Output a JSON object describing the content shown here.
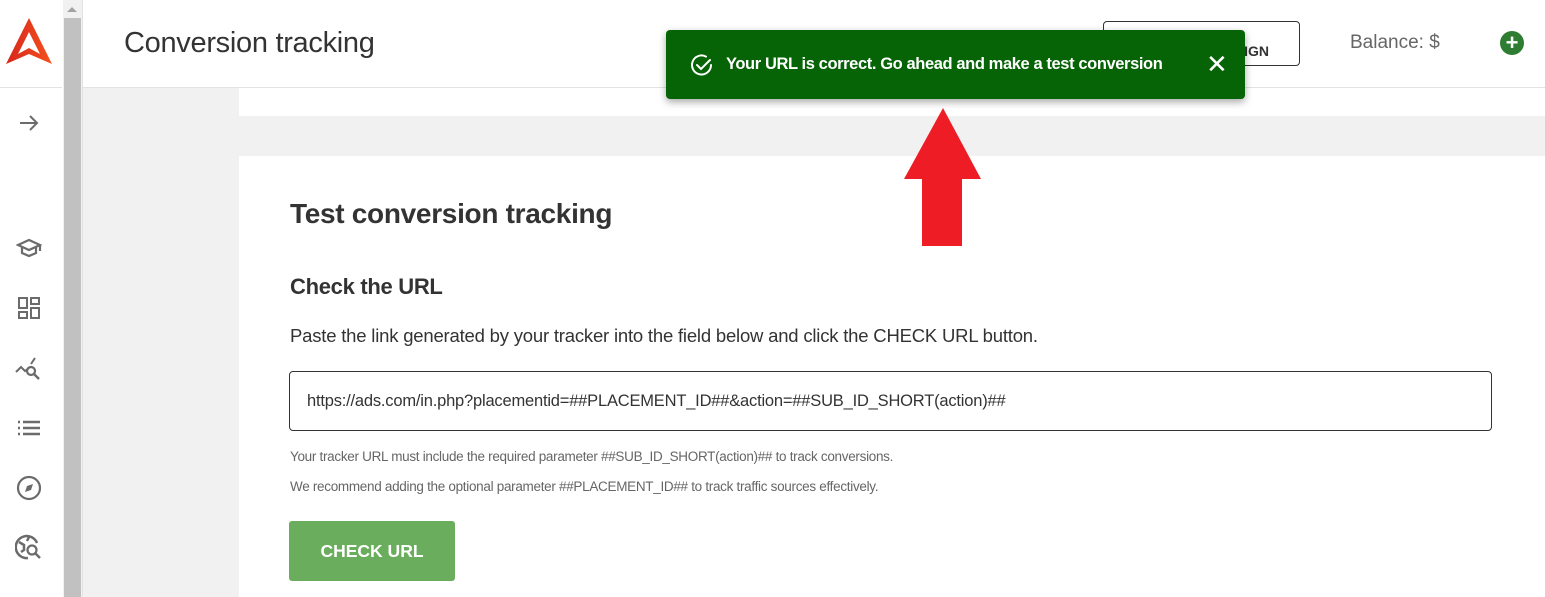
{
  "sidebar": {
    "logo": "A",
    "items": [
      {
        "icon": "arrow-right-icon"
      },
      {
        "icon": "graduation-cap-icon"
      },
      {
        "icon": "dashboard-icon"
      },
      {
        "icon": "analytics-search-icon"
      },
      {
        "icon": "list-icon"
      },
      {
        "icon": "compass-icon"
      },
      {
        "icon": "globe-search-icon"
      }
    ]
  },
  "header": {
    "title": "Conversion tracking",
    "button_label": "IGN",
    "balance_label": "Balance:  $",
    "add_icon": "plus-circle-icon"
  },
  "toast": {
    "message": "Your URL is correct. Go ahead and make a test conversion",
    "close": "✕",
    "color": "#066306"
  },
  "main": {
    "title": "Test conversion tracking",
    "section_title": "Check the URL",
    "instructions": "Paste the link generated by your tracker into the field below and click the CHECK URL button.",
    "url_value": "https://ads.com/in.php?placementid=##PLACEMENT_ID##&action=##SUB_ID_SHORT(action)##",
    "help_1": "Your tracker URL must include the required parameter ##SUB_ID_SHORT(action)## to track conversions.",
    "help_2": "We recommend adding the optional parameter ##PLACEMENT_ID## to track traffic sources effectively.",
    "check_button": "CHECK URL"
  },
  "annotation": {
    "color": "#ee1c25"
  }
}
